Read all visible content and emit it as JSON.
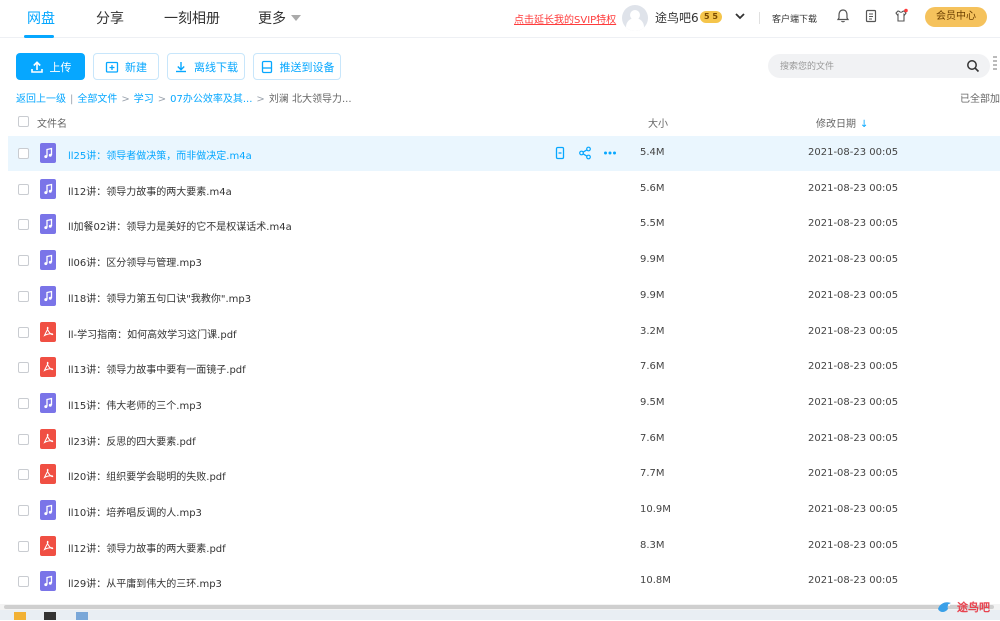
{
  "nav": {
    "tabs": [
      {
        "label": "网盘",
        "active": true
      },
      {
        "label": "分享",
        "active": false
      },
      {
        "label": "一刻相册",
        "active": false
      },
      {
        "label": "更多",
        "active": false
      }
    ],
    "svip_link": "点击延长我的SVIP特权",
    "username": "途鸟吧6",
    "vip_badge": "5 5",
    "client_download": "客户端下载",
    "member_center": "会员中心"
  },
  "toolbar": {
    "upload": "上传",
    "new": "新建",
    "offline_download": "离线下载",
    "push_to_device": "推送到设备",
    "search_placeholder": "搜索您的文件"
  },
  "breadcrumb": {
    "back": "返回上一级",
    "items": [
      "全部文件",
      "学习",
      "07办公效率及其...",
      "刘澜 北大领导力..."
    ],
    "loaded": "已全部加载"
  },
  "table": {
    "headers": {
      "name": "文件名",
      "size": "大小",
      "date": "修改日期"
    },
    "rows": [
      {
        "name": "ll25讲：领导者做决策，而非做决定.m4a",
        "size": "5.4M",
        "date": "2021-08-23 00:05",
        "type": "audio",
        "hover": true
      },
      {
        "name": "ll12讲：领导力故事的两大要素.m4a",
        "size": "5.6M",
        "date": "2021-08-23 00:05",
        "type": "audio"
      },
      {
        "name": "ll加餐02讲：领导力是美好的它不是权谋话术.m4a",
        "size": "5.5M",
        "date": "2021-08-23 00:05",
        "type": "audio"
      },
      {
        "name": "ll06讲：区分领导与管理.mp3",
        "size": "9.9M",
        "date": "2021-08-23 00:05",
        "type": "audio"
      },
      {
        "name": "ll18讲：领导力第五句口诀\"我教你\".mp3",
        "size": "9.9M",
        "date": "2021-08-23 00:05",
        "type": "audio"
      },
      {
        "name": "ll-学习指南：如何高效学习这门课.pdf",
        "size": "3.2M",
        "date": "2021-08-23 00:05",
        "type": "pdf"
      },
      {
        "name": "ll13讲：领导力故事中要有一面镜子.pdf",
        "size": "7.6M",
        "date": "2021-08-23 00:05",
        "type": "pdf"
      },
      {
        "name": "ll15讲：伟大老师的三个.mp3",
        "size": "9.5M",
        "date": "2021-08-23 00:05",
        "type": "audio"
      },
      {
        "name": "ll23讲：反思的四大要素.pdf",
        "size": "7.6M",
        "date": "2021-08-23 00:05",
        "type": "pdf"
      },
      {
        "name": "ll20讲：组织要学会聪明的失败.pdf",
        "size": "7.7M",
        "date": "2021-08-23 00:05",
        "type": "pdf"
      },
      {
        "name": "ll10讲：培养唱反调的人.mp3",
        "size": "10.9M",
        "date": "2021-08-23 00:05",
        "type": "audio"
      },
      {
        "name": "ll12讲：领导力故事的两大要素.pdf",
        "size": "8.3M",
        "date": "2021-08-23 00:05",
        "type": "pdf"
      },
      {
        "name": "ll29讲：从平庸到伟大的三环.mp3",
        "size": "10.8M",
        "date": "2021-08-23 00:05",
        "type": "audio"
      }
    ]
  },
  "icons": {
    "audio": "music-note-icon",
    "pdf": "pdf-icon",
    "row_actions": [
      "phone-push-icon",
      "share-icon",
      "more-icon"
    ]
  },
  "watermark": "途鸟吧",
  "colors": {
    "accent": "#06a7ff",
    "svip": "#ff3c3c",
    "audio": "#7a74e8",
    "pdf": "#f04f43",
    "member": "#f5c25c"
  }
}
